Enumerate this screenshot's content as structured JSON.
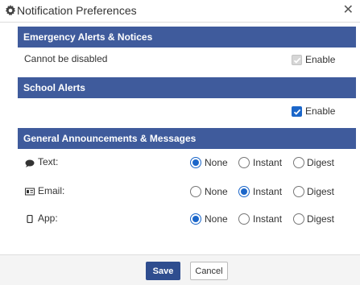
{
  "window": {
    "title": "Notification Preferences",
    "title_icon": "gear-icon",
    "close_icon": "close-icon"
  },
  "sections": {
    "emergency": {
      "header": "Emergency Alerts & Notices",
      "note": "Cannot be disabled",
      "enable_label": "Enable",
      "enabled": true,
      "disabled": true
    },
    "school": {
      "header": "School Alerts",
      "enable_label": "Enable",
      "enabled": true
    },
    "general": {
      "header": "General Announcements & Messages",
      "channels": [
        {
          "label": "Text:",
          "icon": "speech-bubble-icon",
          "selected": "None"
        },
        {
          "label": "Email:",
          "icon": "email-card-icon",
          "selected": "Instant"
        },
        {
          "label": "App:",
          "icon": "phone-icon",
          "selected": "None"
        }
      ],
      "options": [
        "None",
        "Instant",
        "Digest"
      ]
    }
  },
  "footer": {
    "save_label": "Save",
    "cancel_label": "Cancel"
  },
  "colors": {
    "header_bg": "#3f5b9c",
    "accent": "#1b66c9",
    "save_bg": "#2f4d8f"
  }
}
